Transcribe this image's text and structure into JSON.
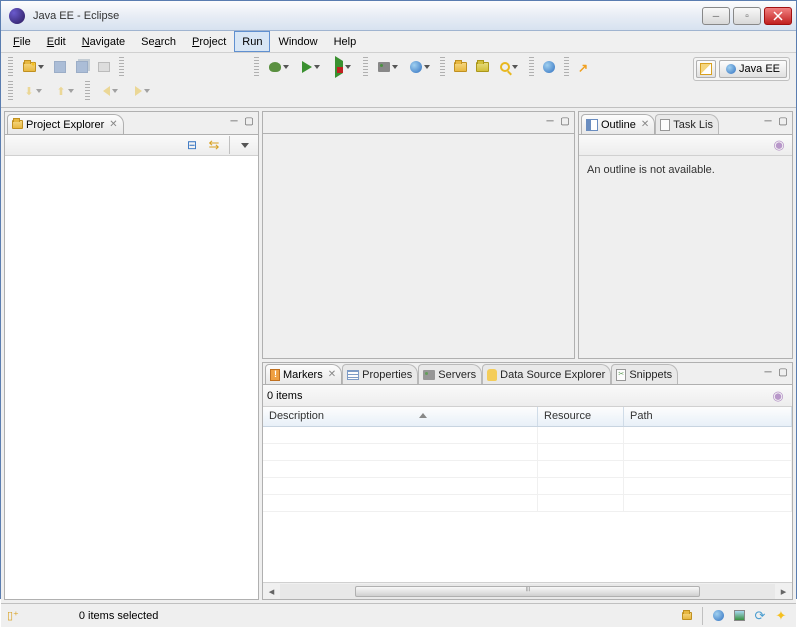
{
  "window": {
    "title": "Java EE - Eclipse"
  },
  "menu": {
    "file": "File",
    "edit": "Edit",
    "navigate": "Navigate",
    "search": "Search",
    "project": "Project",
    "run": "Run",
    "window": "Window",
    "help": "Help"
  },
  "perspective": {
    "label": "Java EE"
  },
  "views": {
    "projectExplorer": {
      "title": "Project Explorer"
    },
    "outline": {
      "title": "Outline",
      "body": "An outline is not available."
    },
    "taskList": {
      "title": "Task Lis"
    },
    "markers": {
      "title": "Markers",
      "count": "0 items",
      "columns": {
        "description": "Description",
        "resource": "Resource",
        "path": "Path"
      }
    },
    "properties": {
      "title": "Properties"
    },
    "servers": {
      "title": "Servers"
    },
    "dataSourceExplorer": {
      "title": "Data Source Explorer"
    },
    "snippets": {
      "title": "Snippets"
    }
  },
  "status": {
    "selection": "0 items selected"
  }
}
